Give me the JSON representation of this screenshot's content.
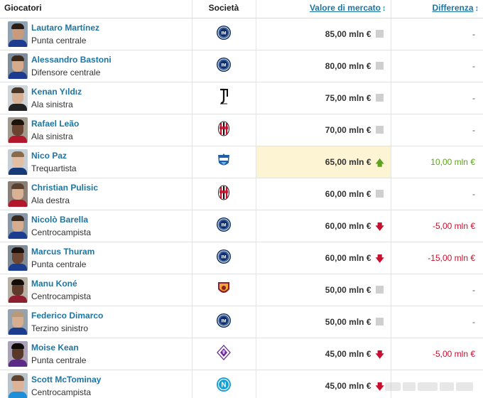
{
  "header": {
    "player_col": "Giocatori",
    "club_col": "Società",
    "value_col": "Valore di mercato",
    "diff_col": "Differenza",
    "sort_icon": "↕"
  },
  "currency_suffix": "mln €",
  "rows": [
    {
      "name": "Lautaro Martínez",
      "position": "Punta centrale",
      "club": "inter",
      "value": "85,00 mln €",
      "trend": "flat",
      "diff": "-",
      "diff_type": "none",
      "skin": "#c99a7b",
      "hair": "#2b1d14",
      "bg": "#8fa3b5",
      "shirt": "#1c3d8f"
    },
    {
      "name": "Alessandro Bastoni",
      "position": "Difensore centrale",
      "club": "inter",
      "value": "80,00 mln €",
      "trend": "flat",
      "diff": "-",
      "diff_type": "none",
      "skin": "#d6ab8c",
      "hair": "#3a2a1c",
      "bg": "#7e8d9c",
      "shirt": "#1c3d8f"
    },
    {
      "name": "Kenan Yıldız",
      "position": "Ala sinistra",
      "club": "juventus",
      "value": "75,00 mln €",
      "trend": "flat",
      "diff": "-",
      "diff_type": "none",
      "skin": "#d8b095",
      "hair": "#4a3626",
      "bg": "#cfd4d9",
      "shirt": "#222222"
    },
    {
      "name": "Rafael Leão",
      "position": "Ala sinistra",
      "club": "milan",
      "value": "70,00 mln €",
      "trend": "flat",
      "diff": "-",
      "diff_type": "none",
      "skin": "#6b4431",
      "hair": "#1b120c",
      "bg": "#a39a8e",
      "shirt": "#b3172b"
    },
    {
      "name": "Nico Paz",
      "position": "Trequartista",
      "club": "como",
      "value": "65,00 mln €",
      "trend": "up",
      "diff": "10,00 mln €",
      "diff_type": "pos",
      "highlight": true,
      "skin": "#e2bea2",
      "hair": "#8a6a4a",
      "bg": "#c6ced6",
      "shirt": "#173b7a"
    },
    {
      "name": "Christian Pulisic",
      "position": "Ala destra",
      "club": "milan",
      "value": "60,00 mln €",
      "trend": "flat",
      "diff": "-",
      "diff_type": "none",
      "skin": "#d9b193",
      "hair": "#5a4230",
      "bg": "#8c7f78",
      "shirt": "#b3172b"
    },
    {
      "name": "Nicolò Barella",
      "position": "Centrocampista",
      "club": "inter",
      "value": "60,00 mln €",
      "trend": "down",
      "diff": "-5,00 mln €",
      "diff_type": "neg",
      "skin": "#d7ad8e",
      "hair": "#3b2a1e",
      "bg": "#8797a8",
      "shirt": "#1c3d8f"
    },
    {
      "name": "Marcus Thuram",
      "position": "Punta centrale",
      "club": "inter",
      "value": "60,00 mln €",
      "trend": "down",
      "diff": "-15,00 mln €",
      "diff_type": "neg",
      "skin": "#6e4634",
      "hair": "#1a110c",
      "bg": "#7f8c98",
      "shirt": "#1c3d8f"
    },
    {
      "name": "Manu Koné",
      "position": "Centrocampista",
      "club": "roma",
      "value": "50,00 mln €",
      "trend": "flat",
      "diff": "-",
      "diff_type": "none",
      "skin": "#5e3b2a",
      "hair": "#120c08",
      "bg": "#b7b0a4",
      "shirt": "#8e1f2f"
    },
    {
      "name": "Federico Dimarco",
      "position": "Terzino sinistro",
      "club": "inter",
      "value": "50,00 mln €",
      "trend": "flat",
      "diff": "-",
      "diff_type": "none",
      "skin": "#d8ae90",
      "hair": "#b79a7e",
      "bg": "#95a3b1",
      "shirt": "#1c3d8f"
    },
    {
      "name": "Moise Kean",
      "position": "Punta centrale",
      "club": "fiorentina",
      "value": "45,00 mln €",
      "trend": "down",
      "diff": "-5,00 mln €",
      "diff_type": "neg",
      "skin": "#5a3828",
      "hair": "#100a07",
      "bg": "#a9a2b8",
      "shirt": "#5b2a86"
    },
    {
      "name": "Scott McTominay",
      "position": "Centrocampista",
      "club": "napoli",
      "value": "45,00 mln €",
      "trend": "down",
      "diff": "",
      "diff_type": "none",
      "skin": "#dcb398",
      "hair": "#5e4330",
      "bg": "#b8c4cc",
      "shirt": "#1e8fd6"
    }
  ],
  "club_names": {
    "inter": "Inter",
    "juventus": "Juventus",
    "milan": "AC Milan",
    "como": "Como 1907",
    "roma": "AS Roma",
    "fiorentina": "Fiorentina",
    "napoli": "SSC Napoli"
  },
  "colors": {
    "link": "#1d75a3",
    "positive": "#5ea21f",
    "negative": "#c8102e",
    "highlight": "#fdf4d3"
  }
}
